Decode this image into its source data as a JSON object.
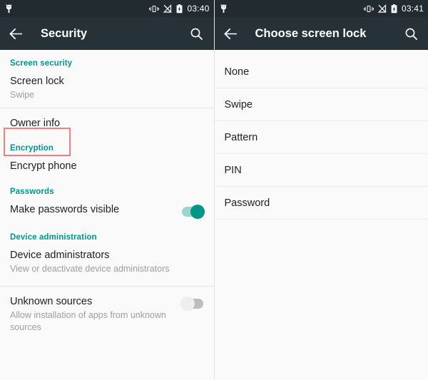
{
  "left_panel": {
    "statusbar": {
      "notification_icon": "android-robot-icon",
      "vibrate_icon": "vibrate-icon",
      "signal_icon": "signal-off-icon",
      "battery_icon": "battery-charging-icon",
      "time": "03:40"
    },
    "appbar": {
      "back_icon": "back-arrow-icon",
      "title": "Security",
      "search_icon": "search-icon"
    },
    "sections": [
      {
        "header": "Screen security",
        "items": [
          {
            "title": "Screen lock",
            "subtitle": "Swipe",
            "highlighted": true
          }
        ]
      },
      {
        "header": "",
        "items": [
          {
            "title": "Owner info",
            "subtitle": ""
          }
        ]
      },
      {
        "header": "Encryption",
        "items": [
          {
            "title": "Encrypt phone",
            "subtitle": ""
          }
        ]
      },
      {
        "header": "Passwords",
        "items": [
          {
            "title": "Make passwords visible",
            "subtitle": "",
            "toggle": "on"
          }
        ]
      },
      {
        "header": "Device administration",
        "items": [
          {
            "title": "Device administrators",
            "subtitle": "View or deactivate device administrators"
          },
          {
            "title": "Unknown sources",
            "subtitle": "Allow installation of apps from unknown sources",
            "toggle": "off"
          }
        ]
      }
    ]
  },
  "right_panel": {
    "statusbar": {
      "notification_icon": "android-robot-icon",
      "vibrate_icon": "vibrate-icon",
      "signal_icon": "signal-off-icon",
      "battery_icon": "battery-charging-icon",
      "time": "03:41"
    },
    "appbar": {
      "back_icon": "back-arrow-icon",
      "title": "Choose screen lock",
      "search_icon": "search-icon"
    },
    "options": [
      {
        "label": "None"
      },
      {
        "label": "Swipe"
      },
      {
        "label": "Pattern"
      },
      {
        "label": "PIN"
      },
      {
        "label": "Password"
      }
    ]
  },
  "colors": {
    "statusbar_bg": "#212b30",
    "appbar_bg": "#263238",
    "accent_teal": "#009688",
    "highlight_border": "#f08080",
    "page_bg": "#fafafa",
    "primary_text": "#212121",
    "secondary_text": "#9e9e9e"
  }
}
